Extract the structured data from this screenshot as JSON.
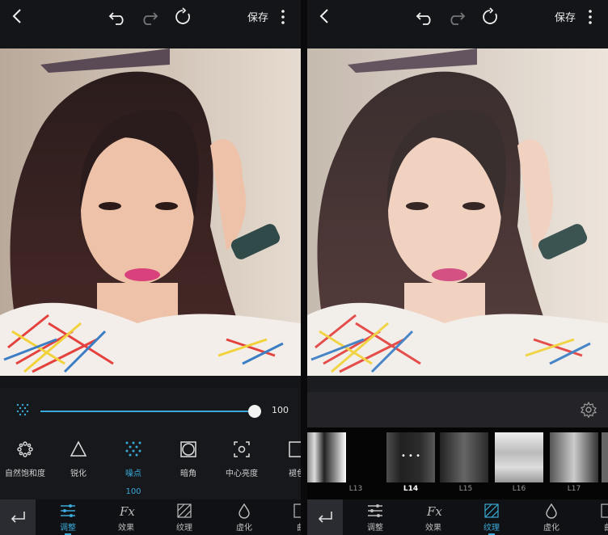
{
  "colors": {
    "accent": "#3aa8d8",
    "panel_bg": "#141519",
    "nav_bg": "#101114"
  },
  "left": {
    "topbar": {
      "save_label": "保存",
      "icons": [
        "back-arrow-icon",
        "undo-icon",
        "redo-icon",
        "reset-icon",
        "more-icon"
      ]
    },
    "slider": {
      "value": "100",
      "value_fraction": 1.0
    },
    "tools": [
      {
        "label": "自然饱和度",
        "icon": "vibrance-icon"
      },
      {
        "label": "锐化",
        "icon": "sharpen-icon"
      },
      {
        "label": "噪点",
        "icon": "noise-icon",
        "active": true,
        "value": "100"
      },
      {
        "label": "暗角",
        "icon": "vignette-icon"
      },
      {
        "label": "中心亮度",
        "icon": "center-brightness-icon"
      },
      {
        "label": "褪色",
        "icon": "fade-icon"
      }
    ],
    "nav": [
      {
        "label": "调整",
        "icon": "adjust-icon",
        "active": true
      },
      {
        "label": "效果",
        "icon": "fx-icon"
      },
      {
        "label": "纹理",
        "icon": "texture-icon"
      },
      {
        "label": "虚化",
        "icon": "blur-icon"
      },
      {
        "label": "曲",
        "icon": "curves-icon"
      }
    ]
  },
  "right": {
    "topbar": {
      "save_label": "保存"
    },
    "textures": [
      {
        "label": "L13"
      },
      {
        "label": "L14",
        "selected": true,
        "more": "• • •"
      },
      {
        "label": "L15"
      },
      {
        "label": "L16"
      },
      {
        "label": "L17"
      }
    ],
    "nav": [
      {
        "label": "调整",
        "icon": "adjust-icon"
      },
      {
        "label": "效果",
        "icon": "fx-icon"
      },
      {
        "label": "纹理",
        "icon": "texture-icon",
        "active": true
      },
      {
        "label": "虚化",
        "icon": "blur-icon"
      },
      {
        "label": "曲",
        "icon": "curves-icon"
      }
    ]
  }
}
